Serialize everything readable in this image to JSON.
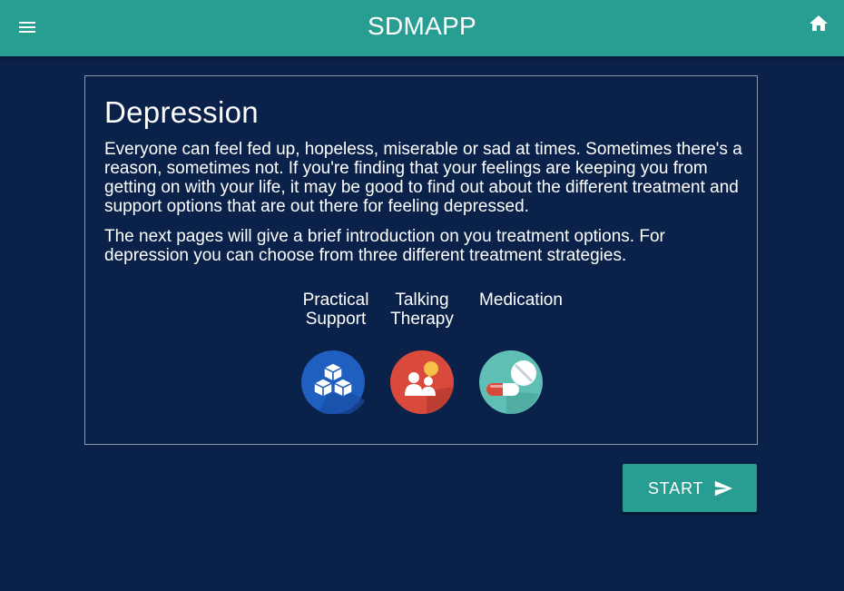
{
  "app": {
    "title": "SDMAPP"
  },
  "icons": {
    "menu": "menu-icon",
    "home": "home-icon",
    "send": "send-icon"
  },
  "card": {
    "title": "Depression",
    "paragraph1": "Everyone can feel fed up, hopeless, miserable or sad at times. Sometimes there's a reason, sometimes not. If you're finding that your feelings are keeping you from getting on with your life, it may be good to find out about the different treatment and support options that are out there for feeling depressed.",
    "paragraph2": "The next pages will give a brief introduction on you treatment options. For depression you can choose from three different treatment strategies.",
    "options": [
      {
        "label": "Practical Support",
        "icon": "cubes-icon",
        "color": "#1e5fc0"
      },
      {
        "label": "Talking Therapy",
        "icon": "people-talking-icon",
        "color": "#d94a3c"
      },
      {
        "label": "Medication",
        "icon": "pills-icon",
        "color": "#5fbfb5"
      }
    ]
  },
  "actions": {
    "start_label": "START"
  },
  "colors": {
    "background": "#0a2149",
    "accent": "#289e92",
    "border": "#8b98b0"
  }
}
